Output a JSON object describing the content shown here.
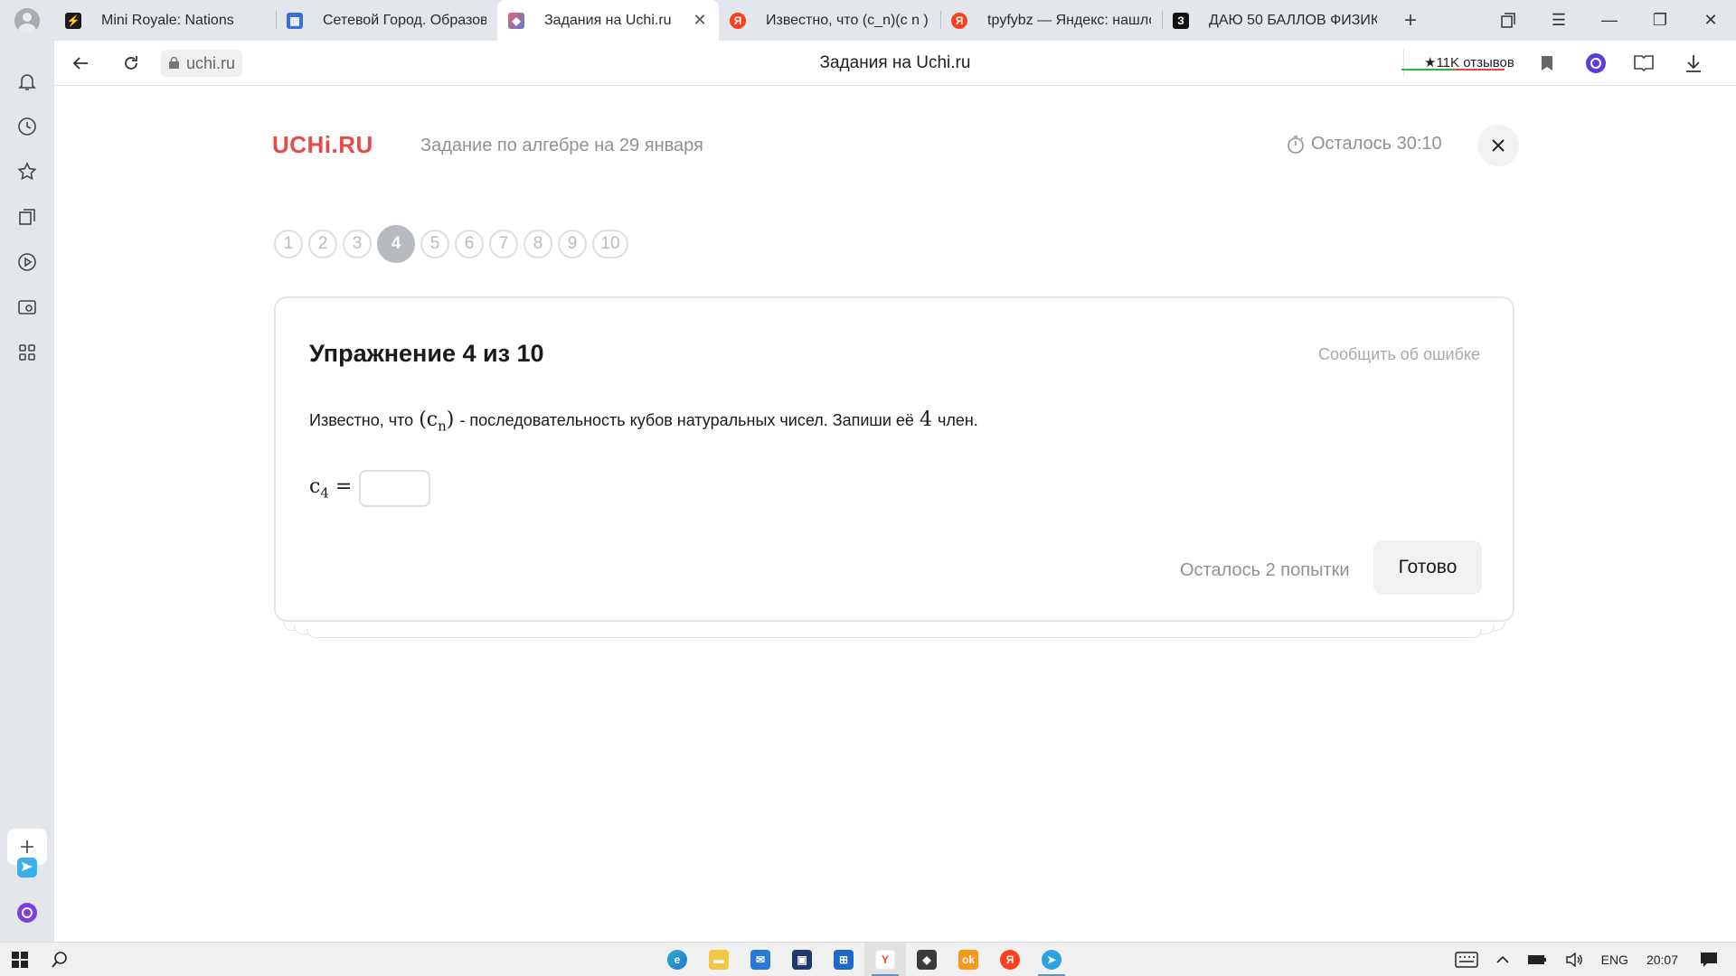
{
  "browser": {
    "tabs": [
      {
        "title": "Mini Royale: Nations",
        "icon": "game-icon",
        "color": "#1c1c1c",
        "active": false
      },
      {
        "title": "Сетевой Город. Образова",
        "icon": "grid-logo-icon",
        "color": "#3a6fd8",
        "active": false
      },
      {
        "title": "Задания на Uchi.ru",
        "icon": "uchi-icon",
        "color": "#e86464",
        "active": true
      },
      {
        "title": "Известно, что (c_n)(c n ) -",
        "icon": "yandex-icon",
        "color": "#fc3f1d",
        "active": false
      },
      {
        "title": "tpyfybz — Яндекс: нашло",
        "icon": "yandex-icon",
        "color": "#fc3f1d",
        "active": false
      },
      {
        "title": "ДАЮ 50 БАЛЛОВ ФИЗИК",
        "icon": "znanija-icon",
        "color": "#111111",
        "active": false
      }
    ],
    "url": "uchi.ru",
    "page_title": "Задания на Uchi.ru",
    "reviews": "★11K отзывов"
  },
  "app": {
    "logo": "UCHi.RU",
    "task_title": "Задание по алгебре на 29 января",
    "timer": "Осталось 30:10",
    "steps": [
      "1",
      "2",
      "3",
      "4",
      "5",
      "6",
      "7",
      "8",
      "9",
      "10"
    ],
    "current_step": "4"
  },
  "exercise": {
    "title": "Упражнение 4 из 10",
    "report_link": "Сообщить об ошибке",
    "question_part1": "Известно, что",
    "question_math1_base": "(c",
    "question_math1_sub": "n",
    "question_math1_end": ")",
    "question_part2": "- последовательность кубов натуральных чисел. Запиши её",
    "question_math2": "4",
    "question_part3": "член.",
    "answer_label_base": "c",
    "answer_label_sub": "4",
    "answer_label_eq": "=",
    "answer_value": "",
    "attempts": "Осталось 2 попытки",
    "submit": "Готово"
  },
  "taskbar": {
    "lang": "ENG",
    "time": "20:07"
  },
  "colors": {
    "brand": "#e84a4a",
    "muted": "#8e9297"
  }
}
